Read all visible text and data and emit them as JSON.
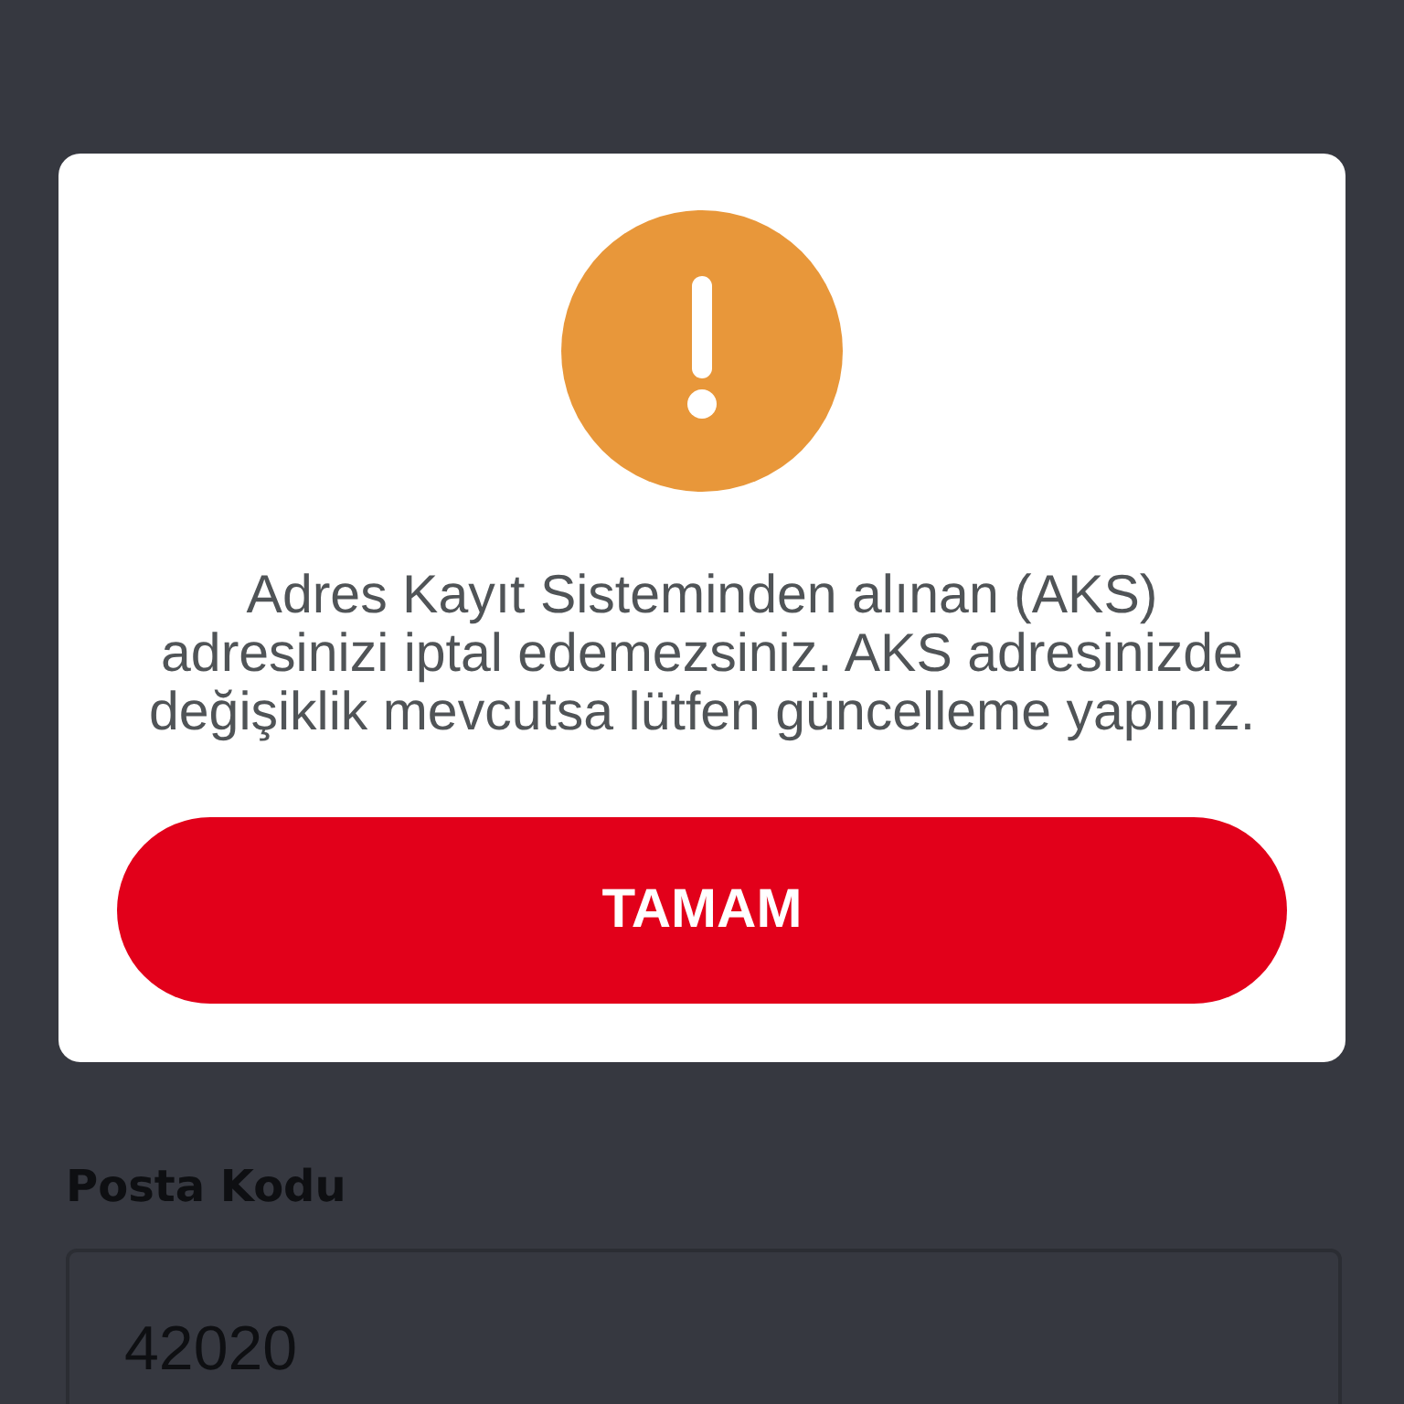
{
  "background_form": {
    "fields": [
      {
        "label": "Posta Kodu",
        "value": "42020"
      }
    ]
  },
  "dialog": {
    "message": "Adres Kayıt Sisteminden alınan (AKS) adresinizi iptal edemezsiniz. AKS adresinizde değişiklik mevcutsa lütfen güncelleme yapınız.",
    "buttons": [
      {
        "label": "TAMAM",
        "kind": "primary"
      }
    ]
  }
}
